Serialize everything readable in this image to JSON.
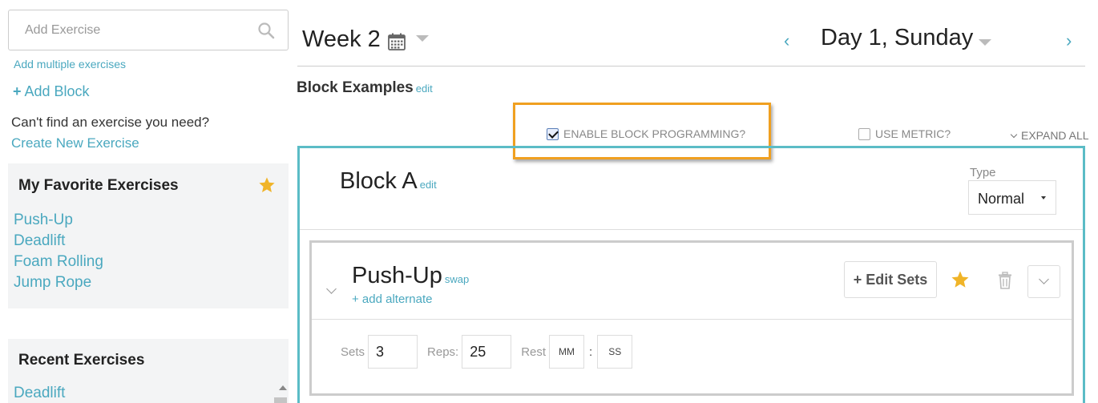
{
  "sidebar": {
    "search": {
      "placeholder": "Add Exercise"
    },
    "add_multiple": "Add multiple exercises",
    "add_block": "Add Block",
    "cant_find": "Can't find an exercise you need?",
    "create_new": "Create New Exercise",
    "favorites": {
      "title": "My Favorite Exercises",
      "items": [
        "Push-Up",
        "Deadlift",
        "Foam Rolling",
        "Jump Rope"
      ]
    },
    "recent": {
      "title": "Recent Exercises",
      "items": [
        "Deadlift"
      ]
    }
  },
  "header": {
    "week": "Week 2",
    "day": "Day 1, Sunday",
    "prev": "‹",
    "next": "›"
  },
  "program": {
    "title": "Block Examples",
    "edit": "edit"
  },
  "options": {
    "enable_block": "ENABLE BLOCK PROGRAMMING?",
    "enable_block_checked": true,
    "use_metric": "USE METRIC?",
    "use_metric_checked": false,
    "expand_all": "EXPAND ALL"
  },
  "block": {
    "title": "Block A",
    "edit": "edit",
    "type_label": "Type",
    "type_value": "Normal",
    "exercise": {
      "name": "Push-Up",
      "swap": "swap",
      "add_alternate": "+ add alternate",
      "edit_sets": "+ Edit Sets",
      "sets_label": "Sets",
      "sets_value": "3",
      "reps_label": "Reps:",
      "reps_value": "25",
      "rest_label": "Rest",
      "rest_mm": "MM",
      "rest_ss": "SS"
    }
  },
  "colors": {
    "accent": "#4aa8bf",
    "block_border": "#5bbcc6",
    "highlight": "#f0a020",
    "star": "#f0b428"
  }
}
